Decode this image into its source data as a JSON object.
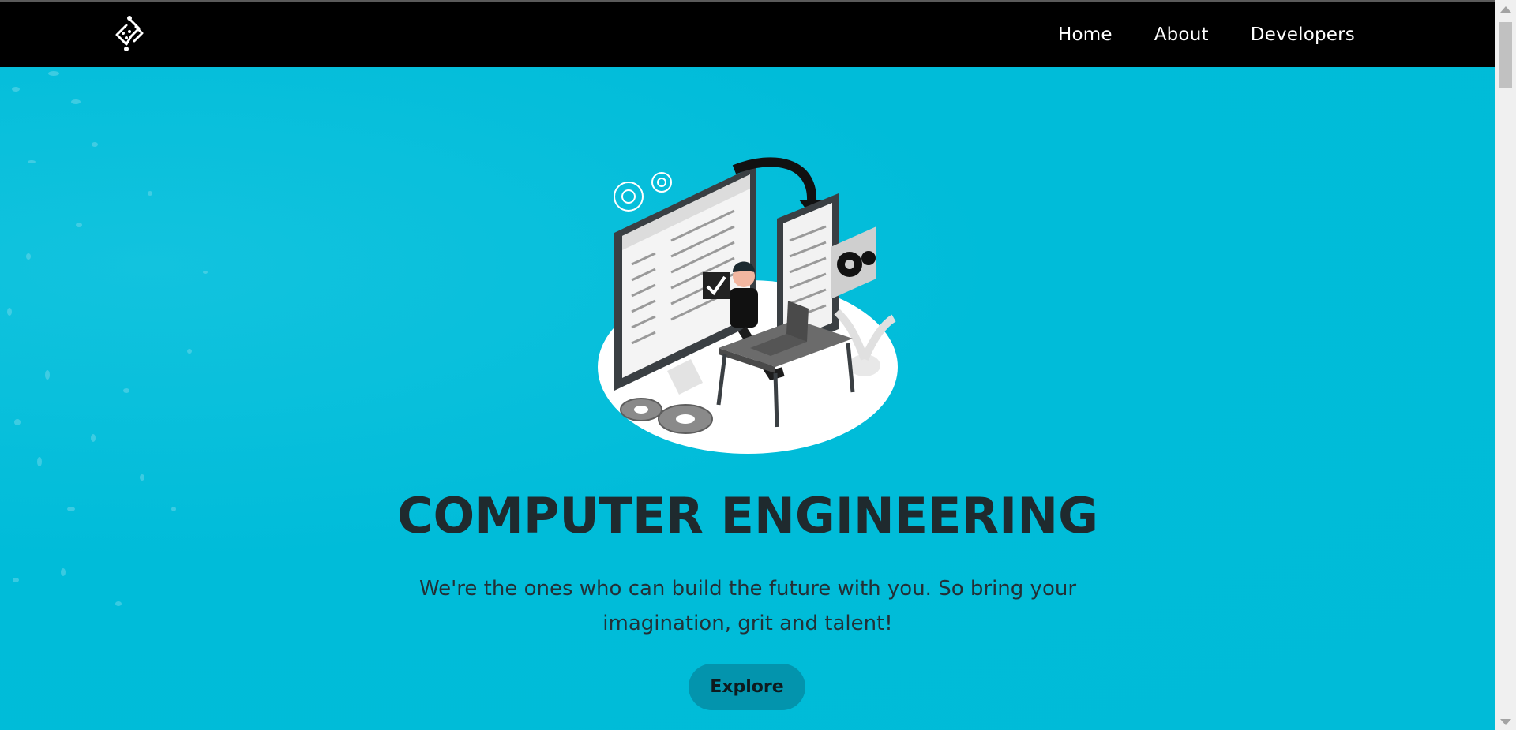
{
  "nav": {
    "logo_icon": "circuit-diamond-logo",
    "links": [
      "Home",
      "About",
      "Developers"
    ]
  },
  "hero": {
    "illustration": "developer-at-desk-illustration",
    "title": "COMPUTER ENGINEERING",
    "subtitle": "We're the ones who can build the future with you. So bring your imagination, grit and talent!",
    "cta_label": "Explore"
  },
  "colors": {
    "navbar": "#000000",
    "hero_background": "#00bcd9",
    "cta_background": "#0394ad",
    "title_text": "#1f2a2e"
  }
}
